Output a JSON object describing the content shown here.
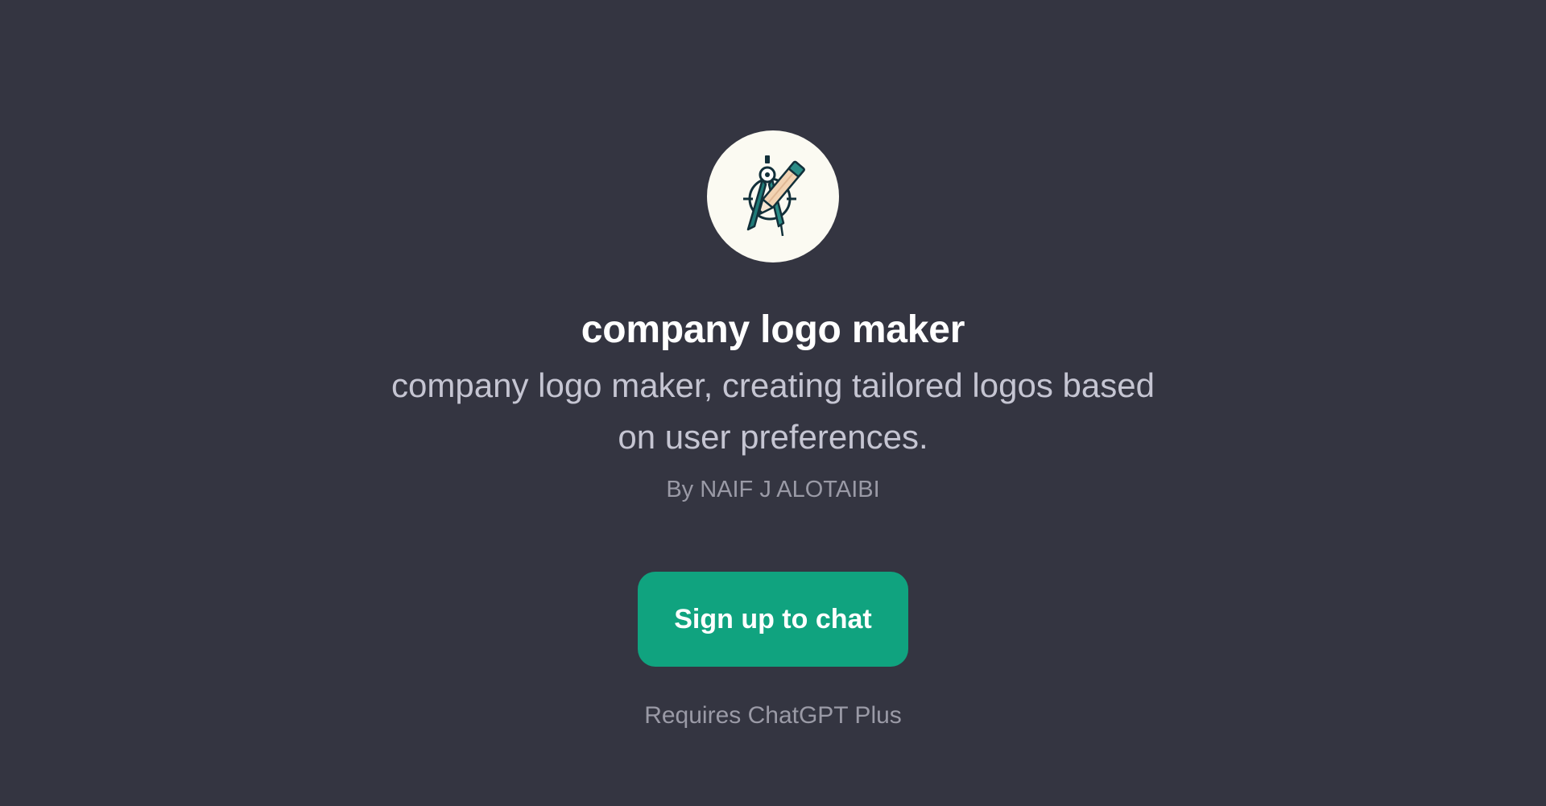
{
  "gpt": {
    "avatar_icon": "compass-pencil-icon",
    "title": "company logo maker",
    "description": "company logo maker, creating tailored logos based on user preferences.",
    "author": "By NAIF J ALOTAIBI"
  },
  "actions": {
    "signup_label": "Sign up to chat",
    "requirement_note": "Requires ChatGPT Plus"
  },
  "colors": {
    "background": "#343541",
    "accent": "#10a37f",
    "avatar_bg": "#fbfaf2",
    "icon_teal": "#1f7b78",
    "icon_dark": "#12303a"
  }
}
